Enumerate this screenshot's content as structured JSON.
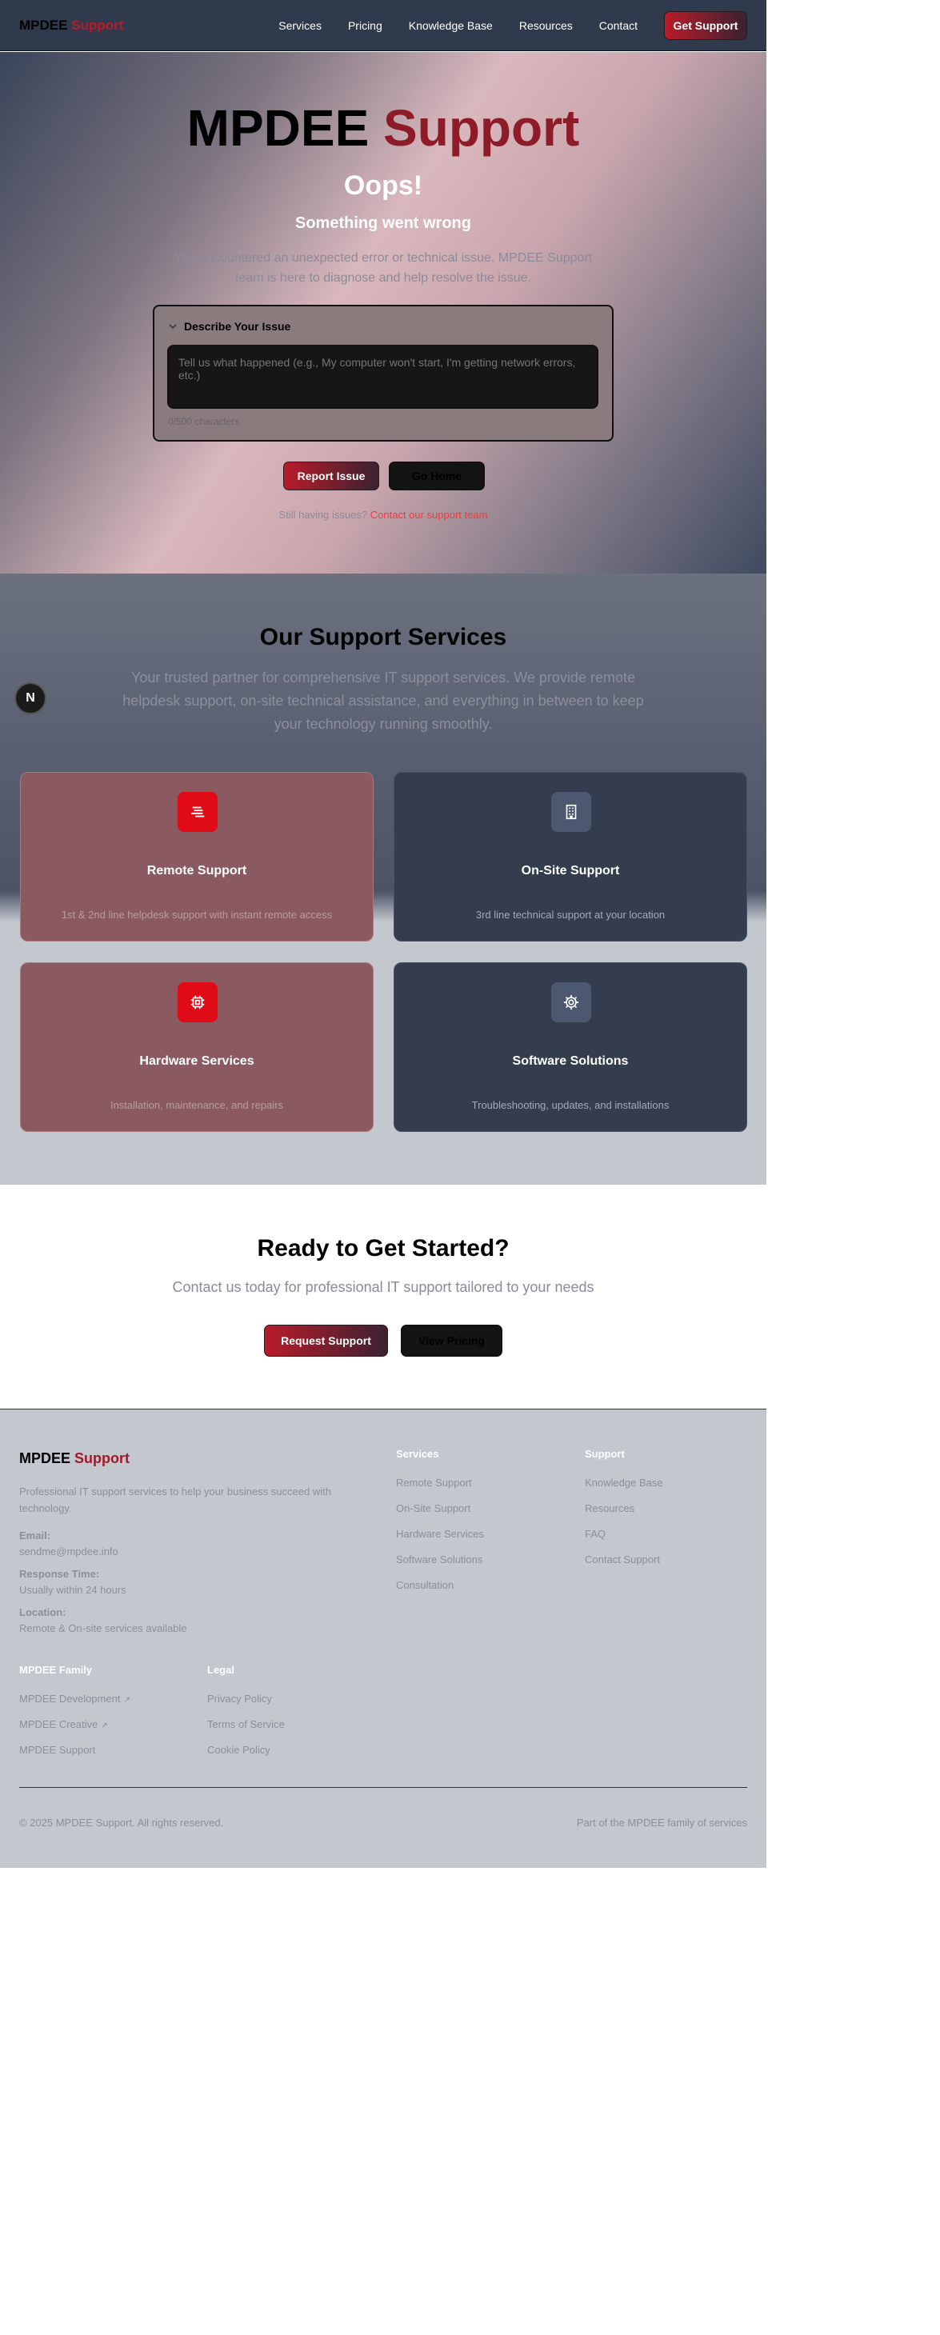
{
  "nav": {
    "brand_a": "MPDEE",
    "brand_b": "Support",
    "links": [
      "Services",
      "Pricing",
      "Knowledge Base",
      "Resources",
      "Contact"
    ],
    "cta": "Get Support"
  },
  "hero": {
    "title_a": "MPDEE",
    "title_b": "Support",
    "oops": "Oops!",
    "subtitle": "Something went wrong",
    "description": "You encountered an unexpected error or technical issue. MPDEE Support team is here to diagnose and help resolve the issue.",
    "issue_header": "Describe Your Issue",
    "issue_placeholder": "Tell us what happened (e.g., My computer won't start, I'm getting network errors, etc.)",
    "char_count": "0/500 characters",
    "report_button": "Report Issue",
    "home_button": "Go Home",
    "still_text": "Still having issues?",
    "still_link": "Contact our support team"
  },
  "services": {
    "title": "Our Support Services",
    "lead": "Your trusted partner for comprehensive IT support services. We provide remote helpdesk support, on-site technical assistance, and everything in between to keep your technology running smoothly.",
    "float_label": "N",
    "cards": [
      {
        "title": "Remote Support",
        "desc": "1st & 2nd line helpdesk support with instant remote access",
        "icon": "laptop-icon"
      },
      {
        "title": "On-Site Support",
        "desc": "3rd line technical support at your location",
        "icon": "building-icon"
      },
      {
        "title": "Hardware Services",
        "desc": "Installation, maintenance, and repairs",
        "icon": "chip-icon"
      },
      {
        "title": "Software Solutions",
        "desc": "Troubleshooting, updates, and installations",
        "icon": "gear-icon"
      }
    ]
  },
  "cta": {
    "title": "Ready to Get Started?",
    "text": "Contact us today for professional IT support tailored to your needs",
    "primary": "Request Support",
    "secondary": "View Pricing"
  },
  "footer": {
    "brand_a": "MPDEE",
    "brand_b": "Support",
    "desc": "Professional IT support services to help your business succeed with technology.",
    "email_label": "Email:",
    "email": "sendme@mpdee.info",
    "response_label": "Response Time:",
    "response": "Usually within 24 hours",
    "location_label": "Location:",
    "location": "Remote & On-site services available",
    "services_heading": "Services",
    "services_links": [
      "Remote Support",
      "On-Site Support",
      "Hardware Services",
      "Software Solutions",
      "Consultation"
    ],
    "support_heading": "Support",
    "support_links": [
      "Knowledge Base",
      "Resources",
      "FAQ",
      "Contact Support"
    ],
    "family_heading": "MPDEE Family",
    "family_links": [
      "MPDEE Development",
      "MPDEE Creative",
      "MPDEE Support"
    ],
    "legal_heading": "Legal",
    "legal_links": [
      "Privacy Policy",
      "Terms of Service",
      "Cookie Policy"
    ],
    "copyright": "© 2025 MPDEE Support. All rights reserved.",
    "part_of": "Part of the MPDEE family of services"
  }
}
